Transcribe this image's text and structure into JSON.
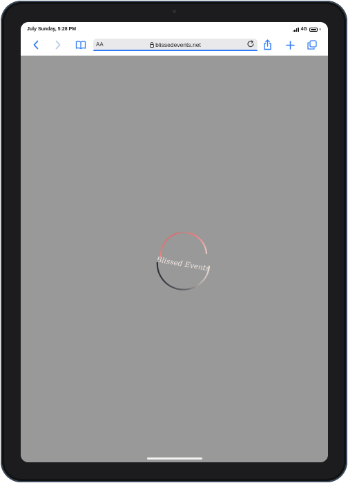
{
  "status": {
    "time": "July Sunday, 5:28 PM",
    "network": "4G"
  },
  "toolbar": {
    "back_icon": "chevron-left-icon",
    "forward_icon": "chevron-right-icon",
    "bookmarks_icon": "book-icon",
    "share_icon": "share-icon",
    "new_tab_icon": "plus-icon",
    "tabs_icon": "tabs-icon"
  },
  "address_bar": {
    "reader_label": "AA",
    "url": "blissedevents.net",
    "load_progress": 1.0
  },
  "page": {
    "background_color": "#989998",
    "logo_text": "Blissed Events"
  },
  "colors": {
    "accent": "#2f7bf6",
    "logo_arc_top": "#e37a7a",
    "logo_arc_bottom": "#2b2f36",
    "logo_arc_right": "#e8d8d2"
  }
}
